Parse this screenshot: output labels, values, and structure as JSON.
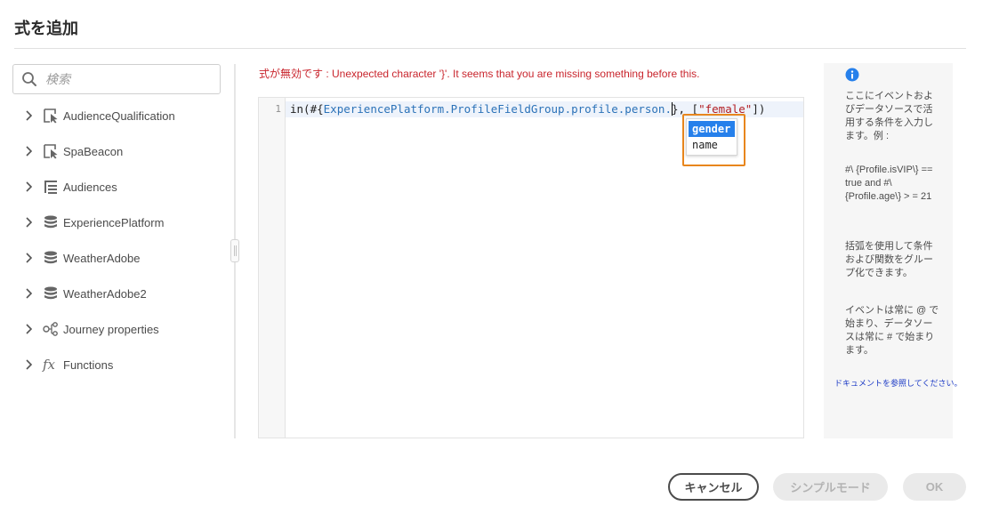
{
  "dialog": {
    "title": "式を追加"
  },
  "search": {
    "placeholder": "検索"
  },
  "tree": [
    {
      "label": "AudienceQualification",
      "icon": "event-cursor-icon"
    },
    {
      "label": "SpaBeacon",
      "icon": "event-cursor-icon"
    },
    {
      "label": "Audiences",
      "icon": "list-tree-icon"
    },
    {
      "label": "ExperiencePlatform",
      "icon": "database-icon"
    },
    {
      "label": "WeatherAdobe",
      "icon": "database-icon"
    },
    {
      "label": "WeatherAdobe2",
      "icon": "database-icon"
    },
    {
      "label": "Journey properties",
      "icon": "hierarchy-icon"
    },
    {
      "label": "Functions",
      "icon": "function-fx-icon"
    }
  ],
  "error": {
    "prefix": "式が無効です : ",
    "message": "Unexpected character '}'. It seems that you are missing something before this."
  },
  "editor": {
    "line_number": "1",
    "code_prefix": "in(#{",
    "code_path": "ExperiencePlatform.ProfileFieldGroup.profile.person.",
    "code_mid": "}, [",
    "code_string": "\"female\"",
    "code_suffix": "])"
  },
  "autocomplete": {
    "items": [
      "gender",
      "name"
    ],
    "selected": "gender"
  },
  "help": {
    "p1": "ここにイベントおよびデータソースで活用する条件を入力します。例 :",
    "p2": "#\\ {Profile.isVIP\\} == true and #\\ {Profile.age\\} > = 21",
    "p3": "括弧を使用して条件および関数をグループ化できます。",
    "p4": "イベントは常に @ で始まり、データソースは常に # で始まります。",
    "doc_link": "ドキュメントを参照してください。"
  },
  "buttons": {
    "cancel": "キャンセル",
    "simple_mode": "シンプルモード",
    "ok": "OK"
  },
  "colors": {
    "accent": "#2680eb",
    "error": "#c9252d",
    "highlight_frame": "#e8861d",
    "link": "#1e3cc6"
  }
}
